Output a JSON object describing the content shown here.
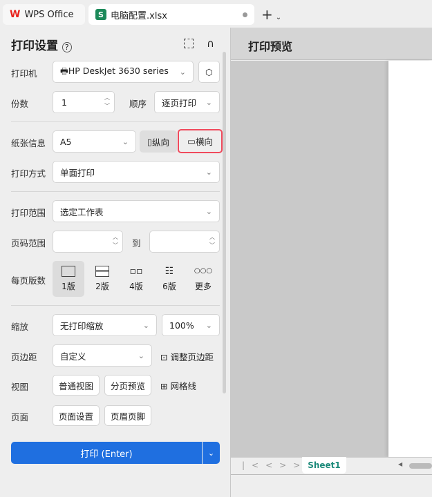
{
  "tabs": [
    {
      "label": "WPS Office"
    },
    {
      "label": "电脑配置.xlsx"
    }
  ],
  "panel": {
    "title": "打印设置",
    "printer_label": "打印机",
    "printer_value": "HP DeskJet 3630 series",
    "copies_label": "份数",
    "copies_value": "1",
    "order_label": "顺序",
    "order_value": "逐页打印",
    "paper_label": "纸张信息",
    "paper_value": "A5",
    "portrait": "纵向",
    "landscape": "横向",
    "mode_label": "打印方式",
    "mode_value": "单面打印",
    "range_label": "打印范围",
    "range_value": "选定工作表",
    "pages_label": "页码范围",
    "pages_to": "到",
    "layout_label": "每页版数",
    "layouts": [
      "1版",
      "2版",
      "4版",
      "6版",
      "更多"
    ],
    "zoom_label": "缩放",
    "zoom_value": "无打印缩放",
    "zoom_pct": "100%",
    "margin_label": "页边距",
    "margin_value": "自定义",
    "adjust_margin": "调整页边距",
    "view_label": "视图",
    "normal_view": "普通视图",
    "page_break": "分页预览",
    "gridlines": "网格线",
    "page_label": "页面",
    "page_setup": "页面设置",
    "header_footer": "页眉页脚",
    "print_button": "打印 (Enter)"
  },
  "preview": {
    "title": "打印预览",
    "sheet_tab": "Sheet1"
  },
  "colors": {
    "accent": "#1f6fe0",
    "highlight": "#f04a5c",
    "sheet": "#1c8a7a"
  }
}
